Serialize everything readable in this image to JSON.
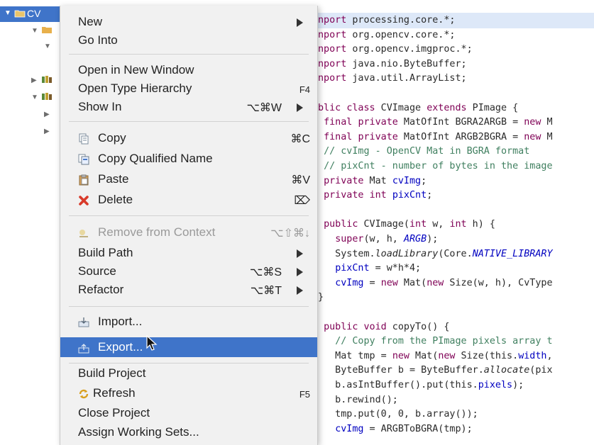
{
  "explorer": {
    "selected_label": "CV"
  },
  "menu": {
    "group1": [
      {
        "label": "New",
        "shortcut": "",
        "submenu": true
      },
      {
        "label": "Go Into",
        "shortcut": "",
        "submenu": false
      }
    ],
    "group2": [
      {
        "label": "Open in New Window",
        "shortcut": "",
        "submenu": false
      },
      {
        "label": "Open Type Hierarchy",
        "shortcut": "F4",
        "submenu": false
      },
      {
        "label": "Show In",
        "shortcut": "⌥⌘W",
        "submenu": true
      }
    ],
    "group3": [
      {
        "label": "Copy",
        "shortcut": "⌘C",
        "icon": "copy-icon"
      },
      {
        "label": "Copy Qualified Name",
        "shortcut": "",
        "icon": "copy-qualified-name-icon"
      },
      {
        "label": "Paste",
        "shortcut": "⌘V",
        "icon": "paste-icon"
      },
      {
        "label": "Delete",
        "shortcut": "⌦",
        "icon": "delete-icon"
      }
    ],
    "group4": [
      {
        "label": "Remove from Context",
        "shortcut": "⌥⇧⌘↓",
        "disabled": true
      },
      {
        "label": "Build Path",
        "shortcut": "",
        "submenu": true
      },
      {
        "label": "Source",
        "shortcut": "⌥⌘S",
        "submenu": true
      },
      {
        "label": "Refactor",
        "shortcut": "⌥⌘T",
        "submenu": true
      }
    ],
    "group5": [
      {
        "label": "Import...",
        "icon": "import-icon"
      },
      {
        "label": "Export...",
        "icon": "export-icon",
        "hover": true
      }
    ],
    "group6": [
      {
        "label": "Build Project",
        "shortcut": ""
      },
      {
        "label": "Refresh",
        "shortcut": "F5",
        "icon": "refresh-icon"
      },
      {
        "label": "Close Project",
        "shortcut": ""
      },
      {
        "label": "Assign Working Sets...",
        "shortcut": ""
      }
    ]
  },
  "code": {
    "lines": [
      "nport processing.core.*;",
      "nport org.opencv.core.*;",
      "nport org.opencv.imgproc.*;",
      "nport java.nio.ByteBuffer;",
      "nport java.util.ArrayList;",
      "",
      "blic class CVImage extends PImage {",
      " final private MatOfInt BGRA2ARGB = new M",
      " final private MatOfInt ARGB2BGRA = new M",
      " // cvImg - OpenCV Mat in BGRA format",
      " // pixCnt - number of bytes in the image",
      " private Mat cvImg;",
      " private int pixCnt;",
      "",
      " public CVImage(int w, int h) {",
      "   super(w, h, ARGB);",
      "   System.loadLibrary(Core.NATIVE_LIBRARY",
      "   pixCnt = w*h*4;",
      "   cvImg = new Mat(new Size(w, h), CvType",
      "}",
      "",
      " public void copyTo() {",
      "   // Copy from the PImage pixels array t",
      "   Mat tmp = new Mat(new Size(this.width,",
      "   ByteBuffer b = ByteBuffer.allocate(pix",
      "   b.asIntBuffer().put(this.pixels);",
      "   b.rewind();",
      "   tmp.put(0, 0, b.array());",
      "   cvImg = ARGBToBGRA(tmp);"
    ]
  },
  "colors": {
    "selection": "#3f74c9",
    "keyword": "#7f0055",
    "comment": "#3f7f5f",
    "field": "#0000c0"
  }
}
